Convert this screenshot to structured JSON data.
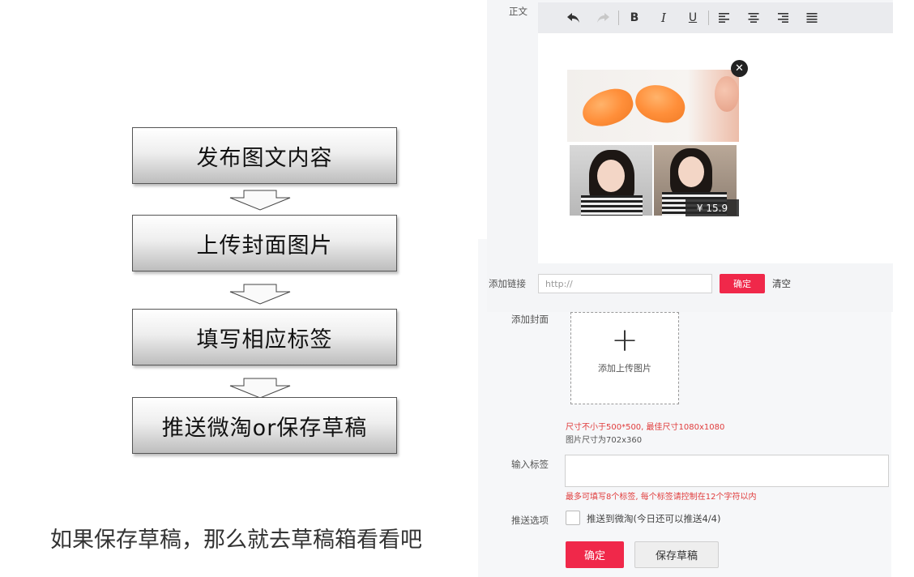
{
  "flowchart": {
    "steps": [
      "发布图文内容",
      "上传封面图片",
      "填写相应标签",
      "推送微淘or保存草稿"
    ]
  },
  "caption": "如果保存草稿，那么就去草稿箱看看吧",
  "editor": {
    "body_label": "正文",
    "toolbar": {
      "undo_icon": "↶",
      "redo_icon": "↷",
      "bold": "B",
      "italic": "I",
      "underline": "U",
      "align_left_icon": "align-left-icon",
      "align_center_icon": "align-center-icon",
      "align_right_icon": "align-right-icon",
      "align_justify_icon": "align-justify-icon"
    },
    "content": {
      "price": "¥ 15.9",
      "close_icon": "✕"
    },
    "link": {
      "label": "添加链接",
      "placeholder": "http://",
      "confirm": "确定",
      "clear": "清空"
    }
  },
  "cover": {
    "label": "添加封面",
    "plus_icon": "+",
    "upload_text": "添加上传图片",
    "hint_size": "尺寸不小于500*500, 最佳尺寸1080x1080",
    "hint_image_size": "图片尺寸为702x360"
  },
  "tags": {
    "label": "输入标签",
    "hint": "最多可填写8个标签, 每个标签请控制在12个字符以内"
  },
  "push": {
    "label": "推送选项",
    "option": "推送到微淘(今日还可以推送4/4)"
  },
  "actions": {
    "confirm": "确定",
    "save_draft": "保存草稿"
  },
  "colors": {
    "accent": "#f0284a",
    "hint_red": "#e03c3c"
  }
}
